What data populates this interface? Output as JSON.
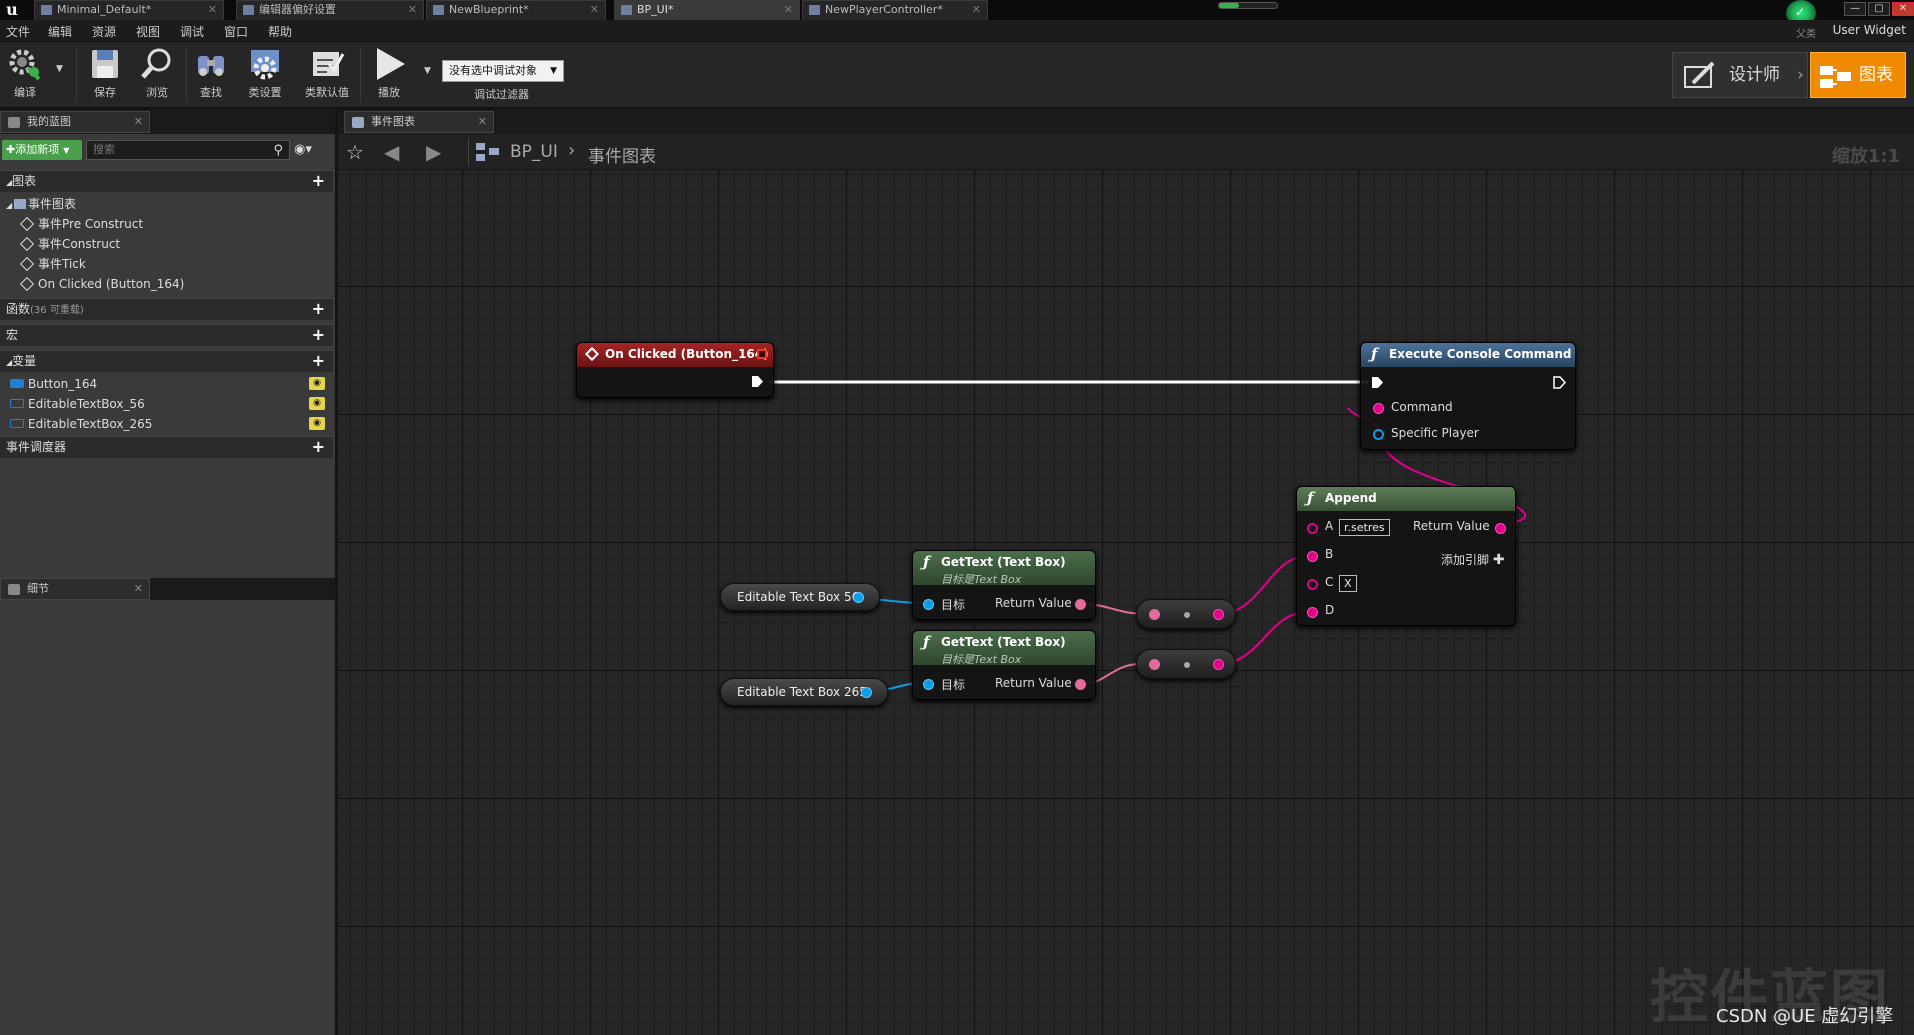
{
  "title_bar": {
    "tabs": [
      {
        "label": "Minimal_Default*"
      },
      {
        "label": "编辑器偏好设置"
      },
      {
        "label": "NewBlueprint*"
      },
      {
        "label": "BP_UI*"
      },
      {
        "label": "NewPlayerController*"
      }
    ],
    "win_min": "—",
    "win_max": "▢",
    "win_close": "✕"
  },
  "menu": {
    "items": [
      "文件",
      "编辑",
      "资源",
      "视图",
      "调试",
      "窗口",
      "帮助"
    ],
    "parent_class_label": "父类",
    "parent_class": "User Widget"
  },
  "toolbar": {
    "compile": "编译",
    "save": "保存",
    "browse": "浏览",
    "find": "查找",
    "class_settings": "类设置",
    "class_defaults": "类默认值",
    "play": "播放",
    "debug_object": "没有选中调试对象",
    "debug_filter": "调试过滤器",
    "designer": "设计师",
    "graph": "图表"
  },
  "my_blueprint": {
    "tab": "我的蓝图",
    "add_new": "添加新项",
    "search_placeholder": "搜索",
    "graphs_header": "图表",
    "event_graph": "事件图表",
    "events": [
      "事件Pre Construct",
      "事件Construct",
      "事件Tick",
      "On Clicked (Button_164)"
    ],
    "functions_header": "函数",
    "functions_sub": "(36 可重载)",
    "macros_header": "宏",
    "variables_header": "变量",
    "variables": [
      {
        "name": "Button_164",
        "color": "#1f7fd4"
      },
      {
        "name": "EditableTextBox_56",
        "color": "#1f7fd4"
      },
      {
        "name": "EditableTextBox_265",
        "color": "#1f7fd4"
      }
    ],
    "dispatchers_header": "事件调度器"
  },
  "details": {
    "tab": "细节"
  },
  "graph": {
    "tab": "事件图表",
    "breadcrumb_bp": "BP_UI",
    "breadcrumb_sep": "›",
    "breadcrumb_graph": "事件图表",
    "zoom": "缩放1:1",
    "nodes": {
      "on_clicked": {
        "title": "On Clicked (Button_164)",
        "color": "#8e1a1a"
      },
      "exec_console": {
        "title": "Execute Console Command",
        "pin_command": "Command",
        "pin_player": "Specific Player",
        "color": "#3a5a7a"
      },
      "append": {
        "title": "Append",
        "pin_a": "A",
        "a_value": "r.setres",
        "pin_b": "B",
        "pin_c": "C",
        "c_value": "X",
        "pin_d": "D",
        "return": "Return Value",
        "add_pin": "添加引脚",
        "color": "#4f6a4a"
      },
      "gettext1": {
        "title": "GetText (Text Box)",
        "subtitle": "目标是Text Box",
        "target": "目标",
        "return": "Return Value"
      },
      "gettext2": {
        "title": "GetText (Text Box)",
        "subtitle": "目标是Text Box",
        "target": "目标",
        "return": "Return Value"
      },
      "var1": {
        "label": "Editable Text Box 56"
      },
      "var2": {
        "label": "Editable Text Box 265"
      }
    },
    "colors": {
      "string_pin": "#e2008b",
      "object_pin": "#0a9ee8",
      "text_pin": "#e26b9b",
      "exec": "#ffffff"
    }
  },
  "watermark": "控件蓝图",
  "credit": "CSDN @UE 虚幻引擎"
}
